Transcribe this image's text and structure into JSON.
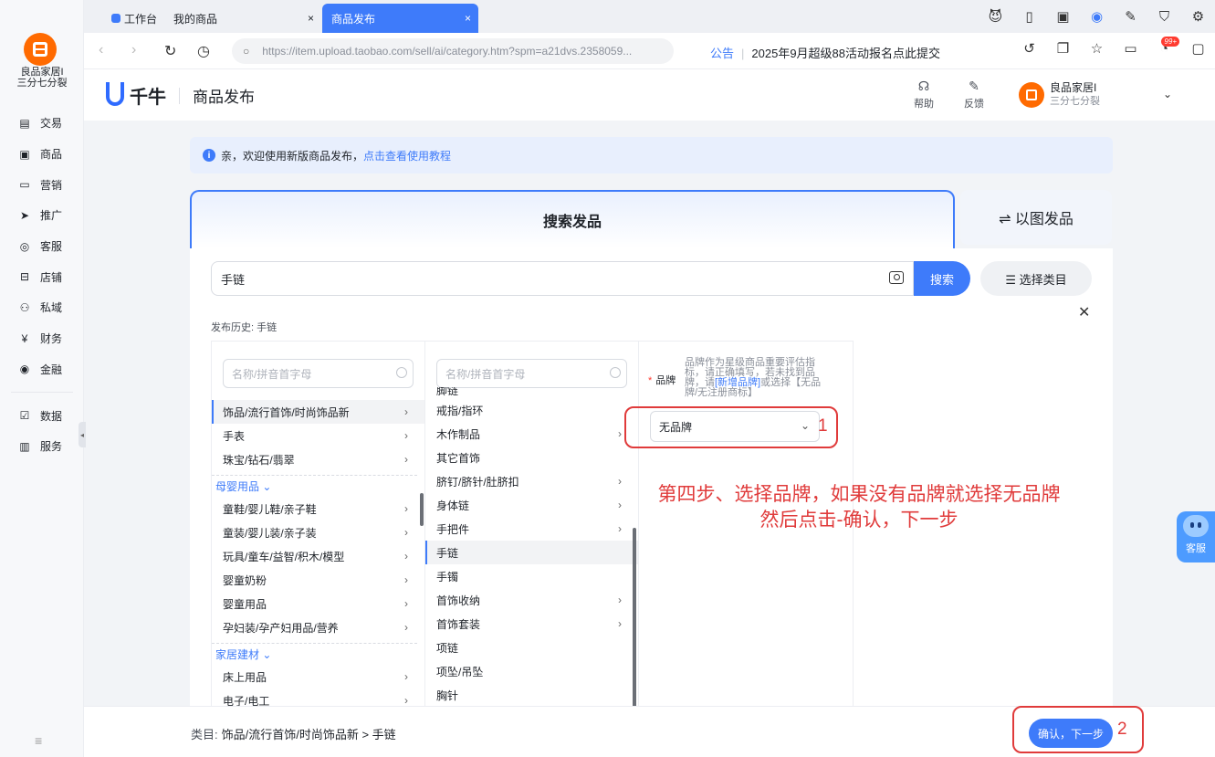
{
  "sidebar": {
    "shop_name_line1": "良品家居I",
    "shop_name_line2": "三分七分裂",
    "items": [
      {
        "label": "交易",
        "icon": "doc-icon"
      },
      {
        "label": "商品",
        "icon": "box-icon"
      },
      {
        "label": "营销",
        "icon": "ticket-icon"
      },
      {
        "label": "推广",
        "icon": "send-icon"
      },
      {
        "label": "客服",
        "icon": "headset-icon"
      },
      {
        "label": "店铺",
        "icon": "store-icon"
      },
      {
        "label": "私域",
        "icon": "users-icon"
      },
      {
        "label": "财务",
        "icon": "yen-icon"
      },
      {
        "label": "金融",
        "icon": "coin-icon"
      },
      {
        "label": "数据",
        "icon": "chart-icon"
      },
      {
        "label": "服务",
        "icon": "service-icon"
      }
    ]
  },
  "tabs": [
    {
      "label": "工作台"
    },
    {
      "label": "我的商品"
    },
    {
      "label": "商品发布"
    }
  ],
  "address": {
    "url": "https://item.upload.taobao.com/sell/ai/category.htm?spm=a21dvs.2358059...",
    "notice_label": "公告",
    "notice_text": "2025年9月超级88活动报名点此提交",
    "badge": "99+"
  },
  "header": {
    "brand": "千牛",
    "page_title": "商品发布",
    "help": "帮助",
    "feedback": "反馈",
    "user_name": "良品家居I",
    "user_sub": "三分七分裂"
  },
  "banner": {
    "text": "亲，欢迎使用新版商品发布，",
    "link": "点击查看使用教程"
  },
  "mode_tabs": {
    "search": "搜索发品",
    "image": "⇌ 以图发品"
  },
  "search": {
    "value": "手链",
    "button": "搜索",
    "category_button": "☰ 选择类目",
    "history_label": "发布历史:",
    "history_value": "手链"
  },
  "col1": {
    "placeholder": "名称/拼音首字母",
    "items_a": [
      "饰品/流行首饰/时尚饰品新",
      "手表",
      "珠宝/钻石/翡翠"
    ],
    "group_b": "母婴用品",
    "items_b": [
      "童鞋/婴儿鞋/亲子鞋",
      "童装/婴儿装/亲子装",
      "玩具/童车/益智/积木/模型",
      "婴童奶粉",
      "婴童用品",
      "孕妇装/孕产妇用品/营养"
    ],
    "group_c": "家居建材",
    "items_c": [
      "床上用品",
      "电子/电工"
    ]
  },
  "col2": {
    "placeholder": "名称/拼音首字母",
    "items": [
      "脚链",
      "戒指/指环",
      "木作制品",
      "其它首饰",
      "脐钉/脐针/肚脐扣",
      "身体链",
      "手把件",
      "手链",
      "手镯",
      "首饰收纳",
      "首饰套装",
      "项链",
      "项坠/吊坠",
      "胸针"
    ]
  },
  "brand": {
    "label": "品牌",
    "hint_a": "品牌作为星级商品重要评估指标，请正确填写，若未找到品牌，请",
    "hint_link": "[新增品牌]",
    "hint_b": "或选择【无品牌/无注册商标】",
    "value": "无品牌"
  },
  "annotation": {
    "n1": "1",
    "line1": "第四步、选择品牌，如果没有品牌就选择无品牌",
    "line2": "然后点击-确认，下一步",
    "n2": "2"
  },
  "float_service": "客服",
  "footer": {
    "path_label": "类目:",
    "path_value": "饰品/流行首饰/时尚饰品新 > 手链",
    "confirm": "确认，下一步"
  }
}
